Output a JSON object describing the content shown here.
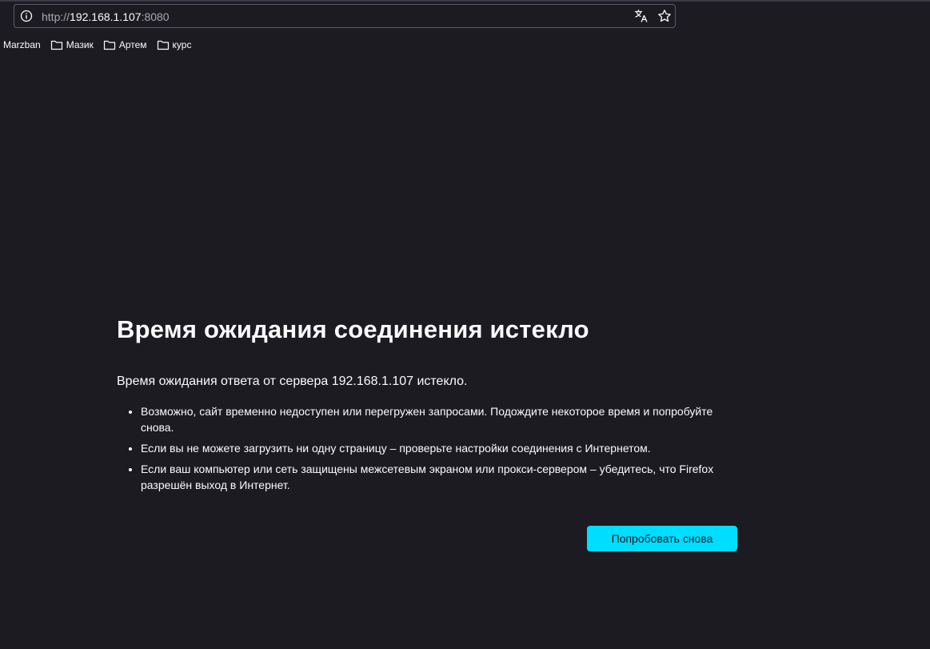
{
  "urlbar": {
    "scheme": "http://",
    "host": "192.168.1.107",
    "port": ":8080",
    "icons": [
      "info-icon",
      "translate-icon",
      "star-icon"
    ]
  },
  "bookmarks": [
    {
      "label": "Marzban",
      "icon": ""
    },
    {
      "label": "Мазик",
      "icon": "folder-icon"
    },
    {
      "label": "Артем",
      "icon": "folder-icon"
    },
    {
      "label": "курс",
      "icon": "folder-icon"
    }
  ],
  "error": {
    "title": "Время ожидания соединения истекло",
    "description": "Время ожидания ответа от сервера 192.168.1.107 истекло.",
    "reasons": [
      "Возможно, сайт временно недоступен или перегружен запросами. Подождите некоторое время и попробуйте снова.",
      "Если вы не можете загрузить ни одну страницу – проверьте настройки соединения с Интернетом.",
      "Если ваш компьютер или сеть защищены межсетевым экраном или прокси-сервером – убедитесь, что Firefox разрешён выход в Интернет."
    ],
    "retry_label": "Попробовать снова"
  },
  "colors": {
    "background": "#1c1b22",
    "accent": "#00ddff",
    "text": "#fbfbfe"
  }
}
